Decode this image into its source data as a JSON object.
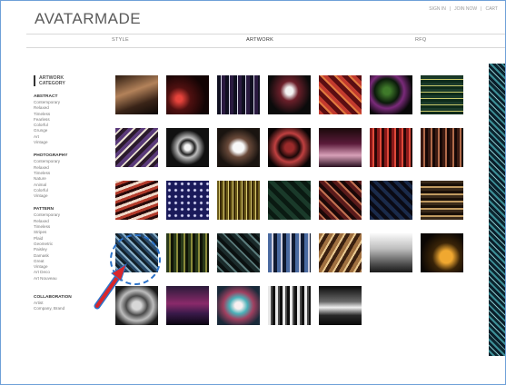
{
  "brand": {
    "logo": "AVATARMADE"
  },
  "topnav": {
    "signin": "SIGN IN",
    "sep1": "|",
    "join": "JOIN NOW",
    "sep2": "|",
    "cart": "CART"
  },
  "mainnav": {
    "tabs": [
      {
        "label": "STYLE"
      },
      {
        "label": "ARTWORK"
      },
      {
        "label": "RFQ"
      }
    ]
  },
  "sidebar": {
    "category_title_1": "ARTWORK",
    "category_title_2": "CATEGORY",
    "sections": [
      {
        "title": "ABSTRACT",
        "items": [
          "Contemporary",
          "Relaxed",
          "Timeless",
          "Fearless",
          "Colorful",
          "Grunge",
          "Art",
          "Vintage"
        ]
      },
      {
        "title": "PHOTOGRAPHY",
        "items": [
          "Contemporary",
          "Relaxed",
          "Timeless",
          "Nature",
          "Animal",
          "Colorful",
          "Vintage"
        ]
      },
      {
        "title": "PATTERN",
        "items": [
          "Contemporary",
          "Relaxed",
          "Timeless",
          "Stripes",
          "Plaid",
          "Geometric",
          "Paisley",
          "Damask",
          "Great",
          "Vintage",
          "Art Deco",
          "Art Nouveau"
        ]
      },
      {
        "title": "COLLABORATION",
        "items": [
          "Artist",
          "Company, Brand"
        ]
      }
    ]
  },
  "artwork_tiles": [
    [
      "artwork-thumb-r1c1",
      "artwork-thumb-r1c2",
      "artwork-thumb-r1c3",
      "artwork-thumb-r1c4",
      "artwork-thumb-r1c5",
      "artwork-thumb-r1c6",
      "artwork-thumb-r1c7"
    ],
    [
      "artwork-thumb-r2c1",
      "artwork-thumb-r2c2",
      "artwork-thumb-r2c3",
      "artwork-thumb-r2c4",
      "artwork-thumb-r2c5",
      "artwork-thumb-r2c6",
      "artwork-thumb-r2c7"
    ],
    [
      "artwork-thumb-r3c1",
      "artwork-thumb-r3c2",
      "artwork-thumb-r3c3",
      "artwork-thumb-r3c4",
      "artwork-thumb-r3c5",
      "artwork-thumb-r3c6",
      "artwork-thumb-r3c7"
    ],
    [
      "artwork-thumb-r4c1",
      "artwork-thumb-r4c2",
      "artwork-thumb-r4c3",
      "artwork-thumb-r4c4",
      "artwork-thumb-r4c5",
      "artwork-thumb-r4c6",
      "artwork-thumb-r4c7"
    ],
    [
      "artwork-thumb-r5c1",
      "artwork-thumb-r5c2",
      "artwork-thumb-r5c3",
      "artwork-thumb-r5c4",
      "artwork-thumb-r5c5"
    ]
  ],
  "colors": {
    "accent": "#2d73c9",
    "arrow": "#d9262b",
    "frame": "#6fa0d8"
  }
}
